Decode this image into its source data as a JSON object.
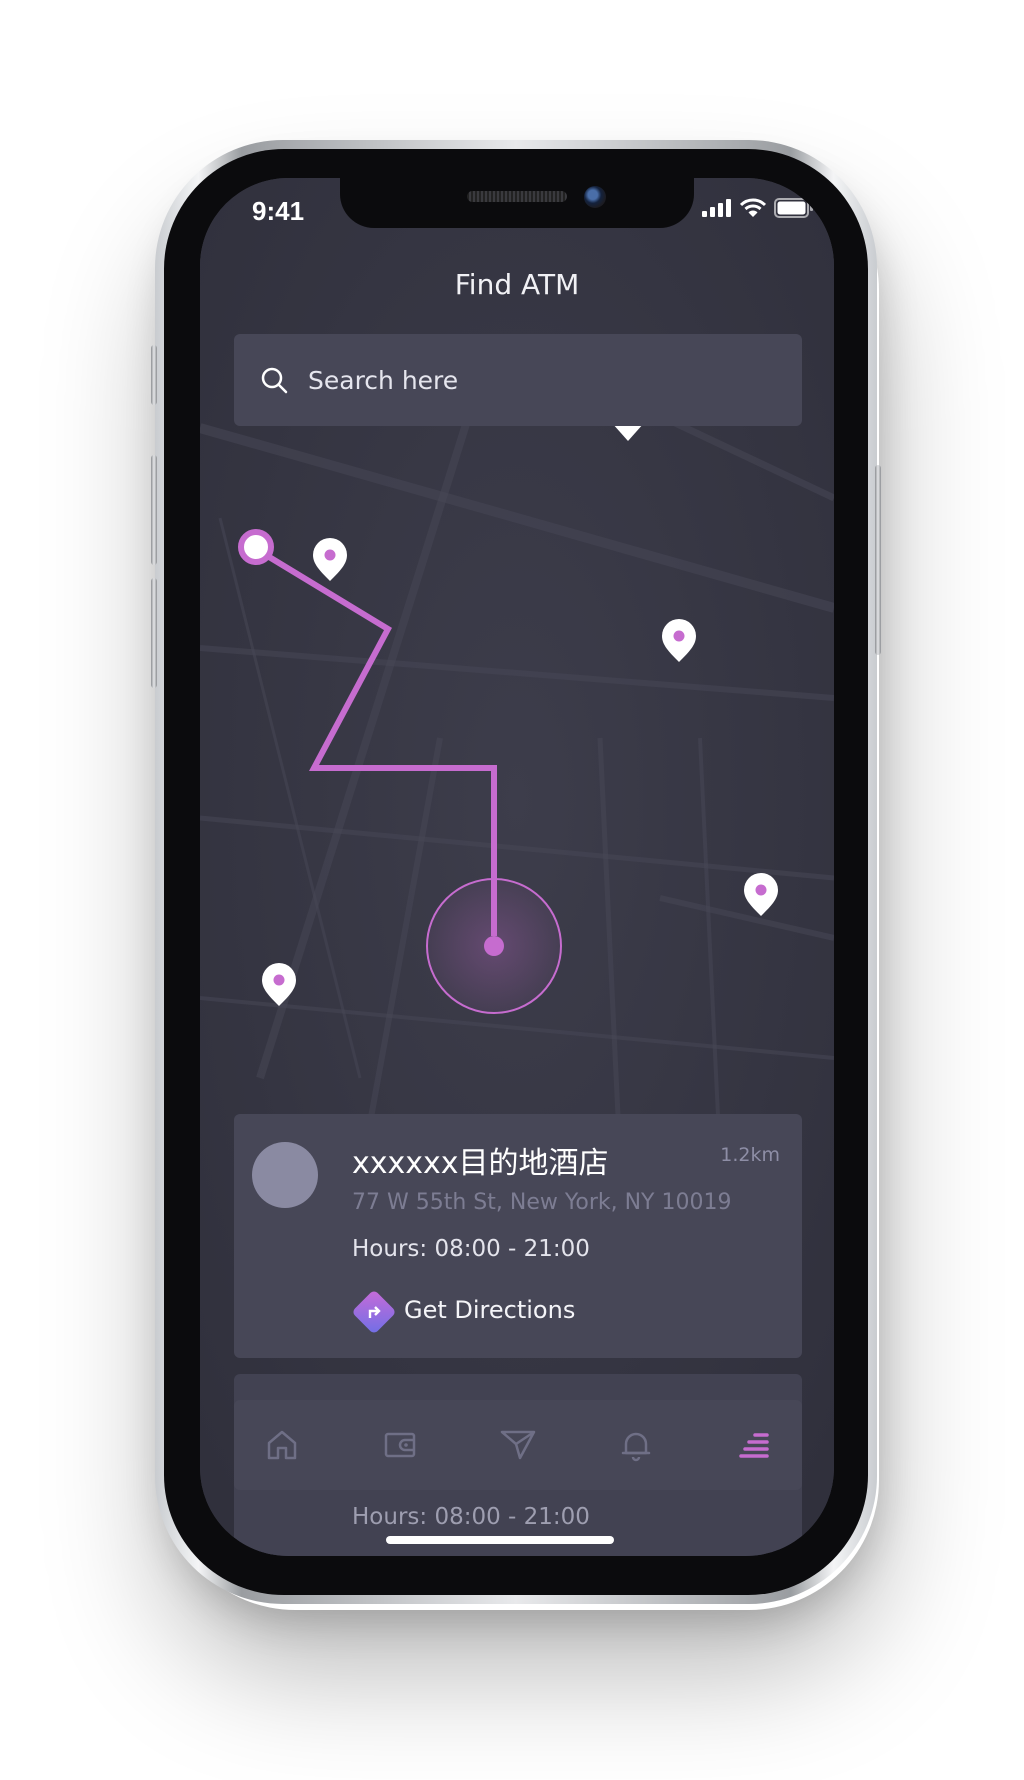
{
  "colors": {
    "accent": "#c66ccf",
    "screen_bg": "#3a3a47",
    "panel_bg": "#474757",
    "muted_text": "#7d7d93"
  },
  "status_bar": {
    "time": "9:41",
    "icons": [
      "cellular-signal-icon",
      "wifi-icon",
      "battery-icon"
    ]
  },
  "header": {
    "title": "Find ATM"
  },
  "search": {
    "placeholder": "Search here",
    "value": ""
  },
  "map": {
    "markers": [
      "location-pin-icon",
      "location-pin-icon",
      "location-pin-icon",
      "location-pin-icon",
      "location-pin-icon"
    ],
    "route": {
      "start": "route-start-point",
      "end": "current-location-marker"
    }
  },
  "location_card": {
    "name": "xxxxxx目的地酒店",
    "distance": "1.2km",
    "address": "77 W 55th St, New York, NY 10019",
    "hours": "Hours: 08:00 - 21:00",
    "action_label": "Get Directions"
  },
  "second_card": {
    "hours": "Hours: 08:00 - 21:00"
  },
  "tab_bar": {
    "items": [
      {
        "icon": "home-icon",
        "active": false
      },
      {
        "icon": "wallet-icon",
        "active": false
      },
      {
        "icon": "send-icon",
        "active": false
      },
      {
        "icon": "bell-icon",
        "active": false
      },
      {
        "icon": "menu-icon",
        "active": true
      }
    ]
  }
}
